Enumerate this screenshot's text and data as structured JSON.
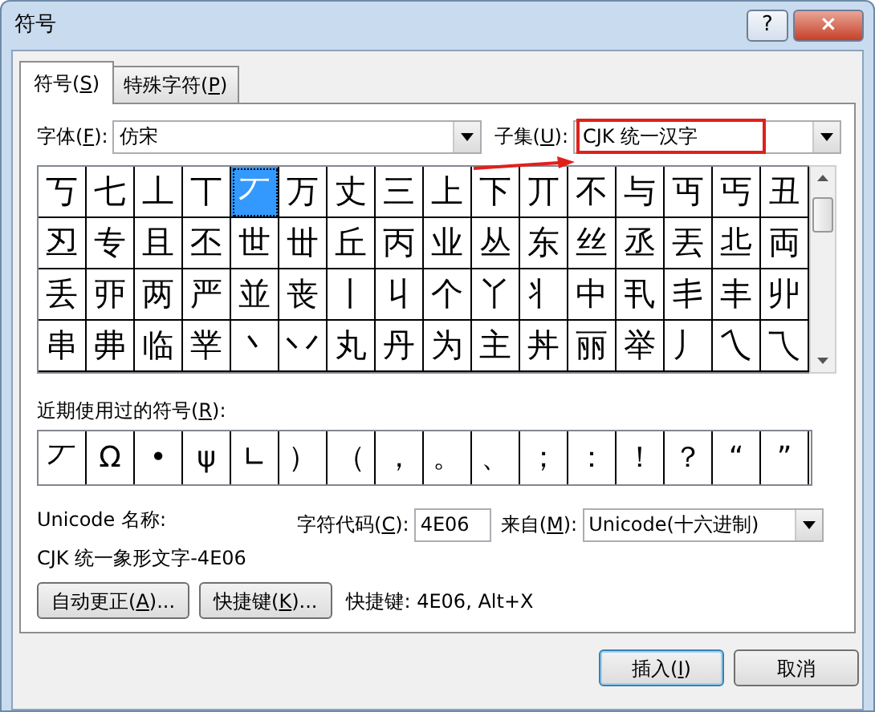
{
  "window": {
    "title": "符号",
    "help": "?",
    "close": "×"
  },
  "tabs": [
    {
      "label": [
        "符号(",
        "S",
        ")"
      ],
      "selected": true
    },
    {
      "label": [
        "特殊字符(",
        "P",
        ")"
      ],
      "selected": false
    }
  ],
  "font": {
    "label": [
      "字体(",
      "F",
      "):"
    ],
    "value": "仿宋"
  },
  "subset": {
    "label": [
      "子集(",
      "U",
      "):"
    ],
    "value": "CJK 统一汉字",
    "highlighted": true
  },
  "grid_rows": [
    {
      "cells": [
        {
          "char": "丂",
          "selected": false
        },
        {
          "char": "七",
          "selected": false
        },
        {
          "char": "丄",
          "selected": false
        },
        {
          "char": "丅",
          "selected": false
        },
        {
          "char": "丆",
          "selected": true
        },
        {
          "char": "万",
          "selected": false
        },
        {
          "char": "丈",
          "selected": false
        },
        {
          "char": "三",
          "selected": false
        },
        {
          "char": "上",
          "selected": false
        },
        {
          "char": "下",
          "selected": false
        },
        {
          "char": "丌",
          "selected": false
        },
        {
          "char": "不",
          "selected": false
        },
        {
          "char": "与",
          "selected": false
        },
        {
          "char": "丏",
          "selected": false
        },
        {
          "char": "丐",
          "selected": false
        },
        {
          "char": "丑",
          "selected": false
        }
      ]
    },
    {
      "cells": [
        {
          "char": "丒",
          "selected": false
        },
        {
          "char": "专",
          "selected": false
        },
        {
          "char": "且",
          "selected": false
        },
        {
          "char": "丕",
          "selected": false
        },
        {
          "char": "世",
          "selected": false
        },
        {
          "char": "丗",
          "selected": false
        },
        {
          "char": "丘",
          "selected": false
        },
        {
          "char": "丙",
          "selected": false
        },
        {
          "char": "业",
          "selected": false
        },
        {
          "char": "丛",
          "selected": false
        },
        {
          "char": "东",
          "selected": false
        },
        {
          "char": "丝",
          "selected": false
        },
        {
          "char": "丞",
          "selected": false
        },
        {
          "char": "丟",
          "selected": false
        },
        {
          "char": "丠",
          "selected": false
        },
        {
          "char": "両",
          "selected": false
        }
      ]
    },
    {
      "cells": [
        {
          "char": "丢",
          "selected": false
        },
        {
          "char": "丣",
          "selected": false
        },
        {
          "char": "两",
          "selected": false
        },
        {
          "char": "严",
          "selected": false
        },
        {
          "char": "並",
          "selected": false
        },
        {
          "char": "丧",
          "selected": false
        },
        {
          "char": "丨",
          "selected": false
        },
        {
          "char": "丩",
          "selected": false
        },
        {
          "char": "个",
          "selected": false
        },
        {
          "char": "丫",
          "selected": false
        },
        {
          "char": "丬",
          "selected": false
        },
        {
          "char": "中",
          "selected": false
        },
        {
          "char": "丮",
          "selected": false
        },
        {
          "char": "丯",
          "selected": false
        },
        {
          "char": "丰",
          "selected": false
        },
        {
          "char": "丱",
          "selected": false
        }
      ]
    },
    {
      "cells": [
        {
          "char": "串",
          "selected": false
        },
        {
          "char": "丳",
          "selected": false
        },
        {
          "char": "临",
          "selected": false
        },
        {
          "char": "丵",
          "selected": false
        },
        {
          "char": "丶",
          "selected": false
        },
        {
          "char": "丷",
          "selected": false
        },
        {
          "char": "丸",
          "selected": false
        },
        {
          "char": "丹",
          "selected": false
        },
        {
          "char": "为",
          "selected": false
        },
        {
          "char": "主",
          "selected": false
        },
        {
          "char": "丼",
          "selected": false
        },
        {
          "char": "丽",
          "selected": false
        },
        {
          "char": "举",
          "selected": false
        },
        {
          "char": "丿",
          "selected": false
        },
        {
          "char": "乀",
          "selected": false
        },
        {
          "char": "乁",
          "selected": false
        }
      ]
    }
  ],
  "recent": {
    "label": [
      "近期使用过的符号(",
      "R",
      "):"
    ],
    "symbols": [
      "丆",
      "Ω",
      "•",
      "ψ",
      "∟",
      "）",
      "（",
      "，",
      "。",
      "、",
      "；",
      "：",
      "！",
      "？",
      "“",
      "”"
    ]
  },
  "unicode_name_label": "Unicode 名称:",
  "unicode_name": "CJK 统一象形文字-4E06",
  "char_code": {
    "label": [
      "字符代码(",
      "C",
      "):"
    ],
    "value": "4E06"
  },
  "from": {
    "label": [
      "来自(",
      "M",
      "):"
    ],
    "value": "Unicode(十六进制)"
  },
  "buttons": [
    {
      "label": [
        "自动更正(",
        "A",
        ")..."
      ]
    },
    {
      "label": [
        "快捷键(",
        "K",
        ")..."
      ]
    }
  ],
  "shortcut_text": "快捷键: 4E06, Alt+X",
  "footer_buttons": [
    {
      "label": [
        "插入(",
        "I",
        ")"
      ],
      "default": true
    },
    {
      "label": [
        "取消"
      ],
      "default": false
    }
  ]
}
